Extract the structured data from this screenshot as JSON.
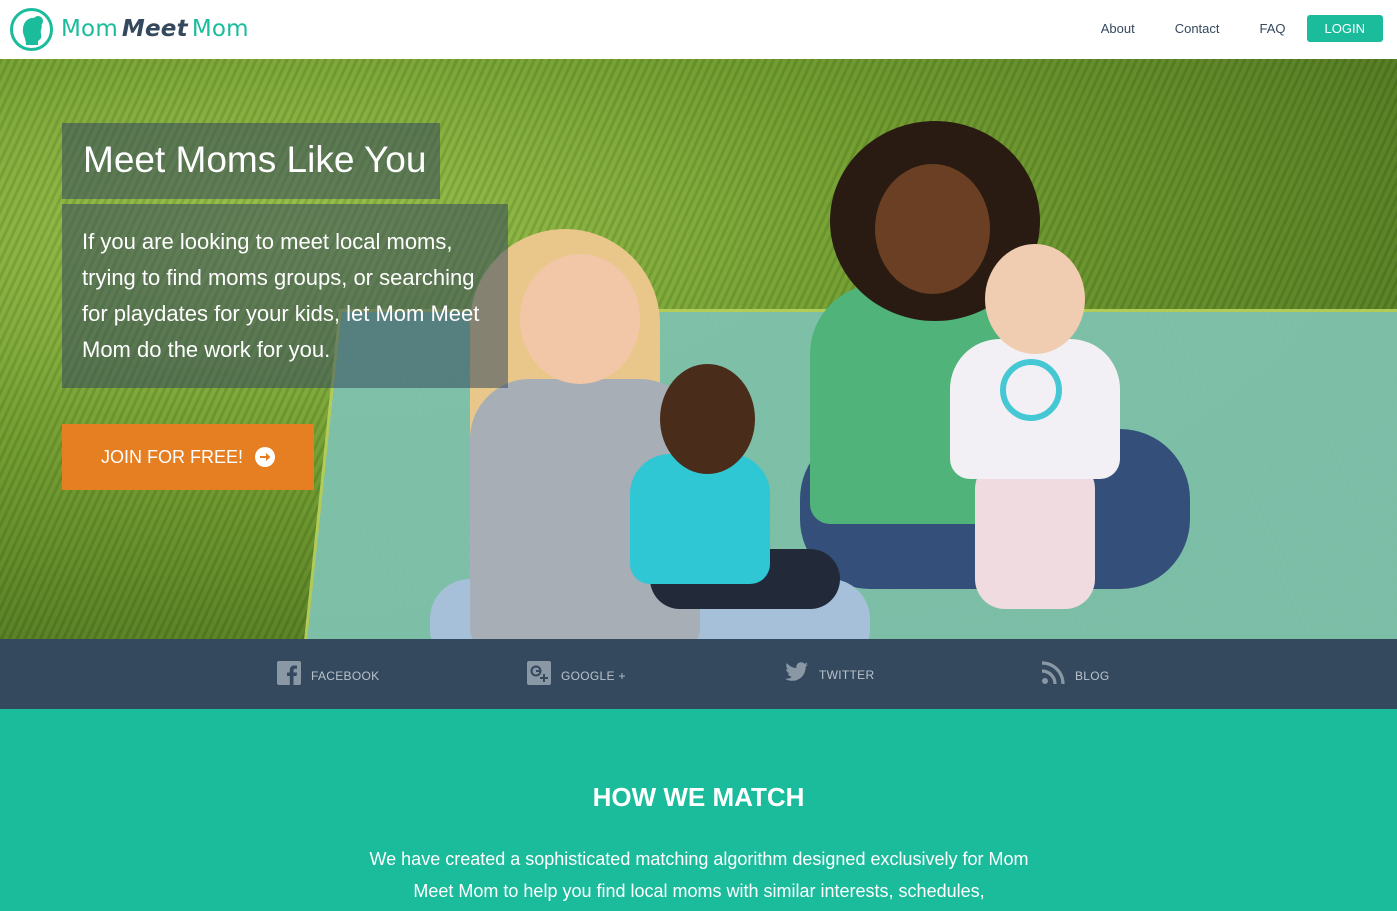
{
  "header": {
    "logo": {
      "part1": "Mom",
      "part2": "Meet",
      "part3": "Mom"
    },
    "nav": [
      {
        "label": "About"
      },
      {
        "label": "Contact"
      },
      {
        "label": "FAQ"
      }
    ],
    "login_label": "LOGIN"
  },
  "hero": {
    "headline": "Meet Moms Like You",
    "description": "If you are looking to meet local moms, trying to find moms groups, or searching for playdates for your kids, let Mom Meet Mom do the work for you.",
    "cta_label": "JOIN FOR FREE!"
  },
  "social": [
    {
      "label": "FACEBOOK",
      "icon": "facebook-icon"
    },
    {
      "label": "GOOGLE +",
      "icon": "google-plus-icon"
    },
    {
      "label": "TWITTER",
      "icon": "twitter-icon"
    },
    {
      "label": "BLOG",
      "icon": "rss-icon"
    }
  ],
  "how_we_match": {
    "title": "HOW WE MATCH",
    "text": "We have created a sophisticated matching algorithm designed exclusively for Mom Meet Mom to help you find local moms with similar interests, schedules,"
  },
  "colors": {
    "accent": "#1abc9c",
    "navy": "#34495e",
    "cta": "#e67e22"
  }
}
